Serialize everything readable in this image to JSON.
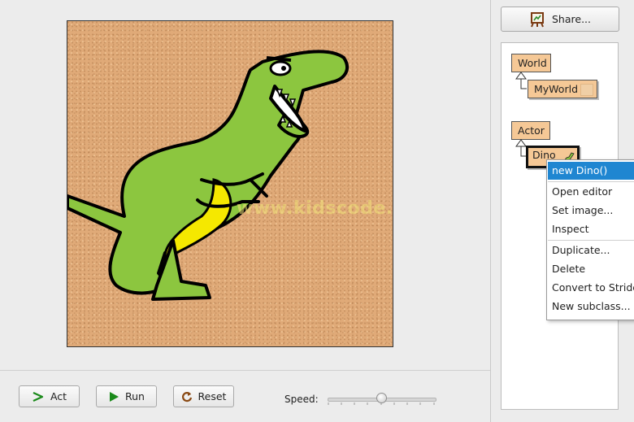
{
  "world": {
    "watermark": "www.kidscode.cn"
  },
  "controls": {
    "act_label": "Act",
    "run_label": "Run",
    "reset_label": "Reset",
    "speed_label": "Speed:",
    "speed_value": 0.5
  },
  "sidebar": {
    "share_label": "Share...",
    "share_icon": "easel-icon",
    "classes": [
      {
        "name": "World"
      },
      {
        "name": "MyWorld"
      },
      {
        "name": "Actor"
      },
      {
        "name": "Dino"
      }
    ]
  },
  "context_menu": {
    "items": [
      {
        "label": "new Dino()"
      },
      {
        "label": "Open editor"
      },
      {
        "label": "Set image..."
      },
      {
        "label": "Inspect"
      },
      {
        "label": "Duplicate..."
      },
      {
        "label": "Delete"
      },
      {
        "label": "Convert to Stride"
      },
      {
        "label": "New subclass..."
      }
    ]
  },
  "colors": {
    "class_box": "#f5c896",
    "highlight": "#1f86d1",
    "dino_green": "#8cc63f",
    "dino_belly": "#f5e800",
    "world_bg": "#e0aa78"
  }
}
